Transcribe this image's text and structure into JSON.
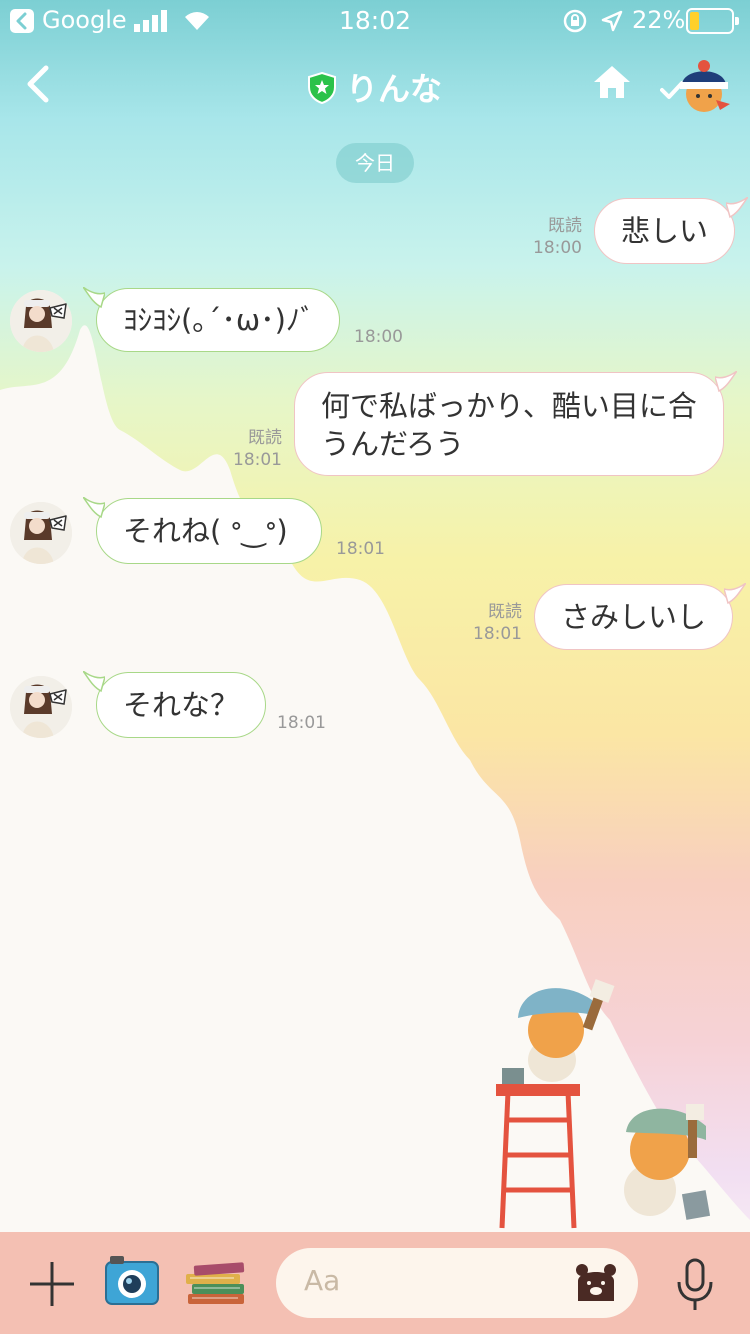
{
  "status_bar": {
    "carrier": "Google",
    "time": "18:02",
    "battery_percent": "22%",
    "battery_level": 0.22,
    "battery_color": "#ffd02a"
  },
  "nav": {
    "title": "りんな",
    "badge_color": "#2bc24a",
    "icons": [
      "chevron-left-icon",
      "shield-star-icon",
      "home-icon",
      "check-icon",
      "sticker-avatar-icon"
    ]
  },
  "chat": {
    "date_label": "今日",
    "read_label": "既読",
    "messages": [
      {
        "side": "out",
        "lines": [
          "悲しい"
        ],
        "time": "18:00",
        "read": true
      },
      {
        "side": "in",
        "lines": [
          "ﾖｼﾖｼ(｡´･ω･)ﾉﾞ"
        ],
        "time": "18:00"
      },
      {
        "side": "out",
        "lines": [
          "何で私ばっかり、酷い目に合",
          "うんだろう"
        ],
        "time": "18:01",
        "read": true
      },
      {
        "side": "in",
        "lines": [
          "それね( ᐤ‿ᐤ)"
        ],
        "time": "18:01"
      },
      {
        "side": "out",
        "lines": [
          "さみしいし"
        ],
        "time": "18:01",
        "read": true
      },
      {
        "side": "in",
        "lines": [
          "それな？"
        ],
        "time": "18:01"
      }
    ]
  },
  "input_bar": {
    "placeholder": "Aa",
    "icons": [
      "plus-icon",
      "camera-icon",
      "books-icon",
      "bear-sticker-icon",
      "microphone-icon"
    ]
  },
  "colors": {
    "bubble_in_border": "#a8d888",
    "bubble_out_border": "#f0c4c4",
    "bottom_bar": "#f4c0b3"
  }
}
